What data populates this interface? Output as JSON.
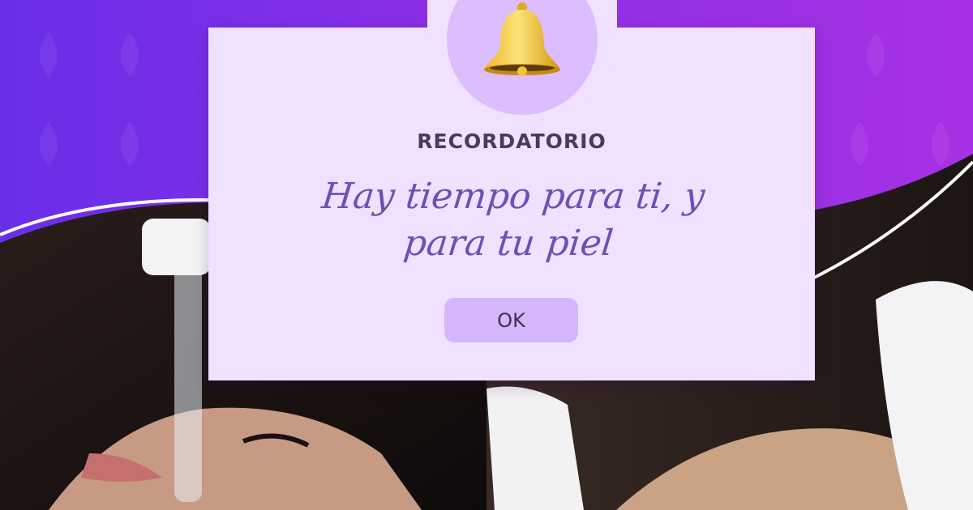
{
  "reminder": {
    "title": "RECORDATORIO",
    "message_line1": "Hay tiempo para ti, y",
    "message_line2": "para tu piel",
    "ok_label": "OK",
    "icon": "bell-icon"
  },
  "colors": {
    "background_start": "#6a2ee8",
    "background_end": "#a731e4",
    "card": "#efe1ff",
    "bell_circle": "#dcbdfd",
    "button": "#d5b6fb",
    "title_text": "#4a3b5d",
    "message_text": "#6f4fb4"
  }
}
